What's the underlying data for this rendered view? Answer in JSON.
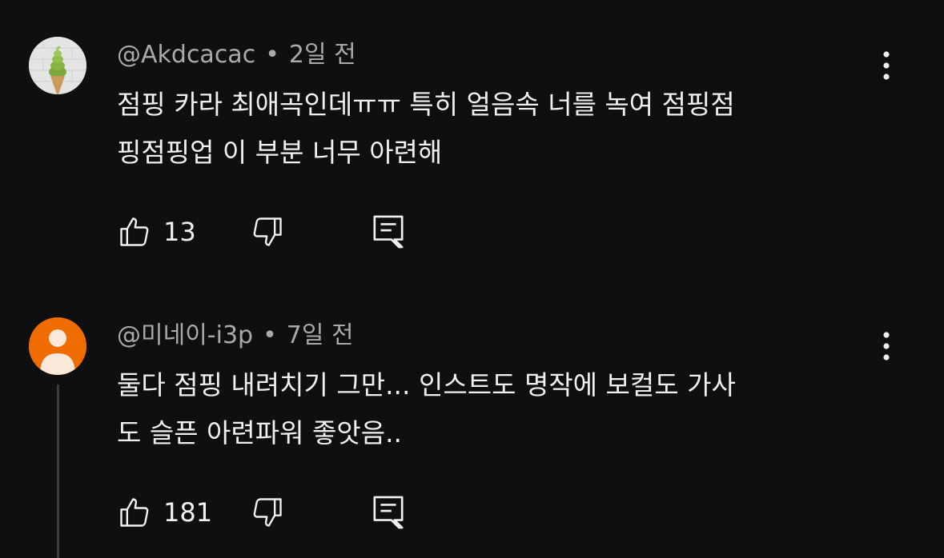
{
  "comments": [
    {
      "author": "@Akdcacac",
      "separator": "•",
      "time": "2일 전",
      "line1": "점핑 카라 최애곡인데ㅠㅠ 특히 얼음속 너를 녹여 점핑점",
      "line2": "핑점핑업 이 부분 너무 아련해",
      "likes": "13",
      "avatar_icon": "matcha-soft-serve-icon"
    },
    {
      "author": "@미네이-i3p",
      "separator": "•",
      "time": "7일 전",
      "line1": "둘다 점핑 내려치기 그만... 인스트도 명작에 보컬도 가사",
      "line2": "도 슬픈 아련파워 좋앗음..",
      "likes": "181",
      "avatar_icon": "default-person-icon"
    }
  ],
  "colors": {
    "background": "#0f0f0f",
    "text": "#f1f1f1",
    "meta": "#aaaaaa",
    "avatar_default": "#ef6c00"
  }
}
